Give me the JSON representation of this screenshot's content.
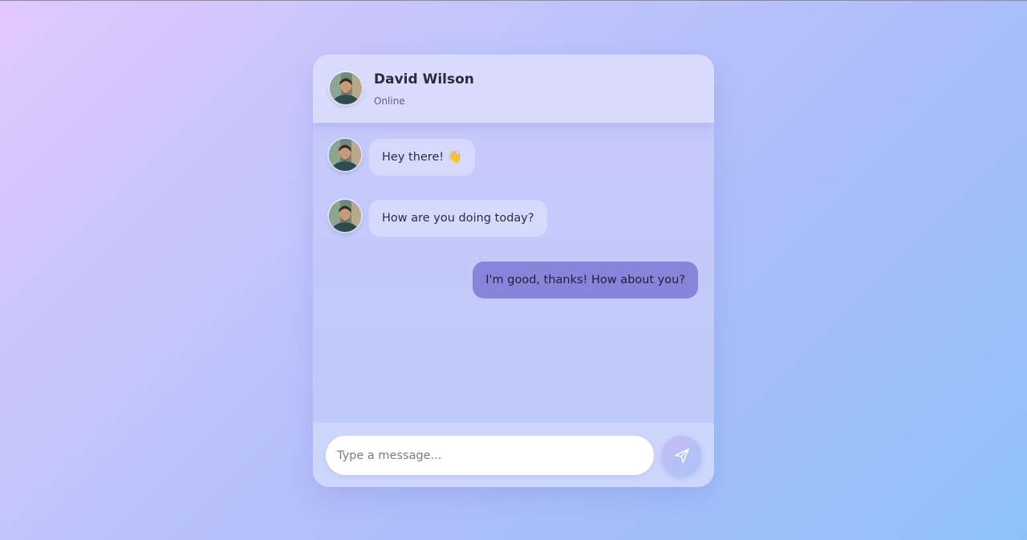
{
  "contact": {
    "name": "David Wilson",
    "status": "Online",
    "avatar_icon": "user-avatar-photo"
  },
  "messages": [
    {
      "direction": "incoming",
      "text": "Hey there! 👋"
    },
    {
      "direction": "incoming",
      "text": "How are you doing today?"
    },
    {
      "direction": "outgoing",
      "text": "I'm good, thanks! How about you?"
    }
  ],
  "composer": {
    "placeholder": "Type a message...",
    "value": "",
    "send_icon": "send-icon"
  },
  "colors": {
    "outgoing_bubble": "#8784dc",
    "incoming_bubble": "#d6dafd",
    "header": "#dadcfd"
  }
}
